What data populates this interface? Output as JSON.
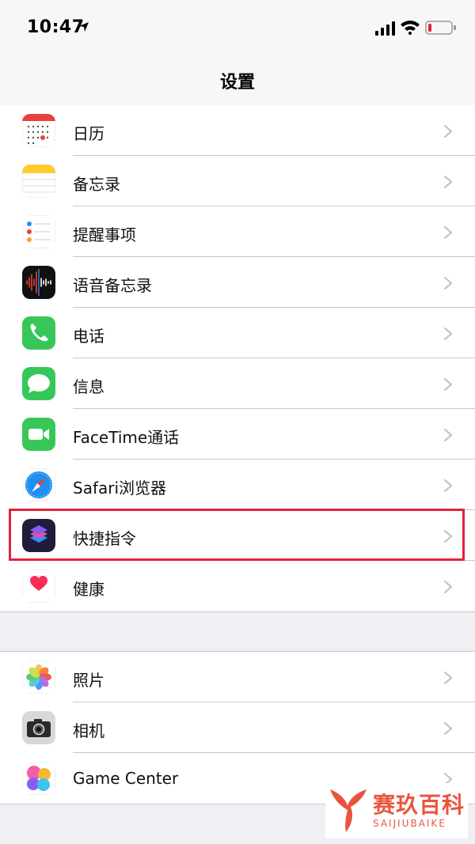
{
  "status": {
    "time": "10:47"
  },
  "nav": {
    "title": "设置"
  },
  "group1": [
    {
      "label": "日历",
      "icon": "calendar-icon"
    },
    {
      "label": "备忘录",
      "icon": "notes-icon"
    },
    {
      "label": "提醒事项",
      "icon": "reminders-icon"
    },
    {
      "label": "语音备忘录",
      "icon": "voice-memos-icon"
    },
    {
      "label": "电话",
      "icon": "phone-icon"
    },
    {
      "label": "信息",
      "icon": "messages-icon"
    },
    {
      "label": "FaceTime通话",
      "icon": "facetime-icon"
    },
    {
      "label": "Safari浏览器",
      "icon": "safari-icon"
    },
    {
      "label": "快捷指令",
      "icon": "shortcuts-icon"
    },
    {
      "label": "健康",
      "icon": "health-icon"
    }
  ],
  "group2": [
    {
      "label": "照片",
      "icon": "photos-icon"
    },
    {
      "label": "相机",
      "icon": "camera-icon"
    },
    {
      "label": "Game Center",
      "icon": "game-center-icon"
    }
  ],
  "watermark": {
    "title": "赛玖百科",
    "subtitle": "SAIJIUBAIKE"
  },
  "colors": {
    "highlight": "#e0243e",
    "separator": "#c8c7cc",
    "background": "#efeff4"
  }
}
